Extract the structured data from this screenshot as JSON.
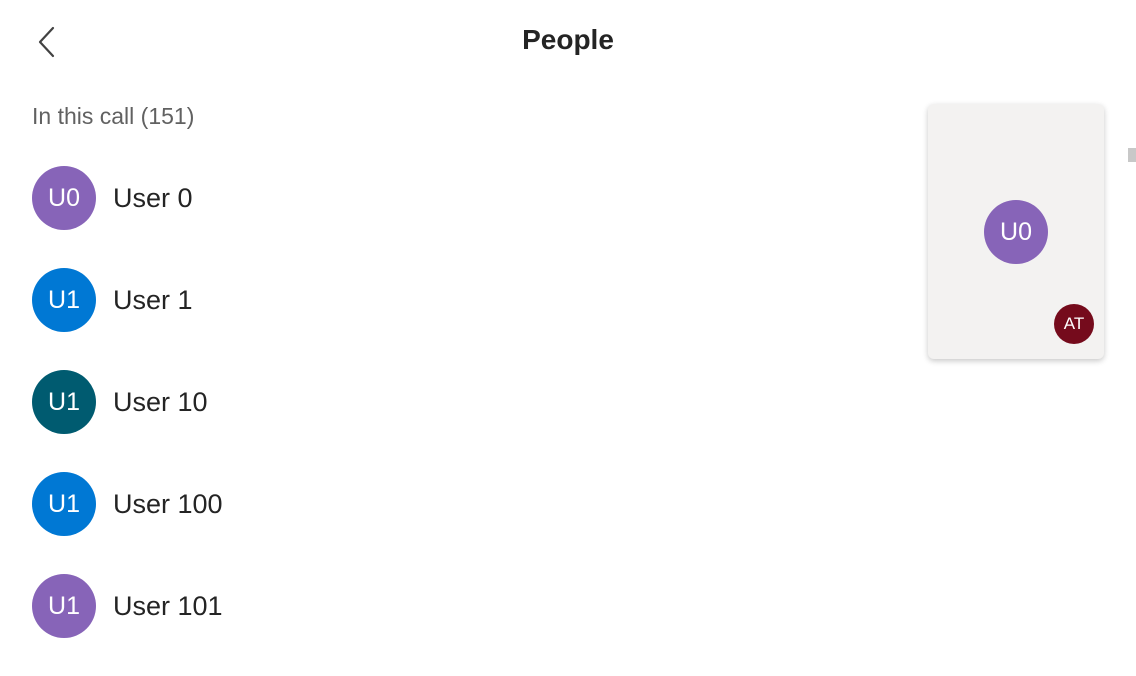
{
  "header": {
    "title": "People",
    "back_icon": "chevron-left-icon"
  },
  "section": {
    "label": "In this call (151)"
  },
  "people": [
    {
      "initials": "U0",
      "name": "User 0",
      "color": "#8764b8"
    },
    {
      "initials": "U1",
      "name": "User 1",
      "color": "#0078d4"
    },
    {
      "initials": "U1",
      "name": "User 10",
      "color": "#005b70"
    },
    {
      "initials": "U1",
      "name": "User 100",
      "color": "#0078d4"
    },
    {
      "initials": "U1",
      "name": "User 101",
      "color": "#8764b8"
    }
  ],
  "video_tile": {
    "participant_initials": "U0",
    "participant_color": "#8764b8",
    "self_initials": "AT",
    "self_color": "#750b1c"
  }
}
